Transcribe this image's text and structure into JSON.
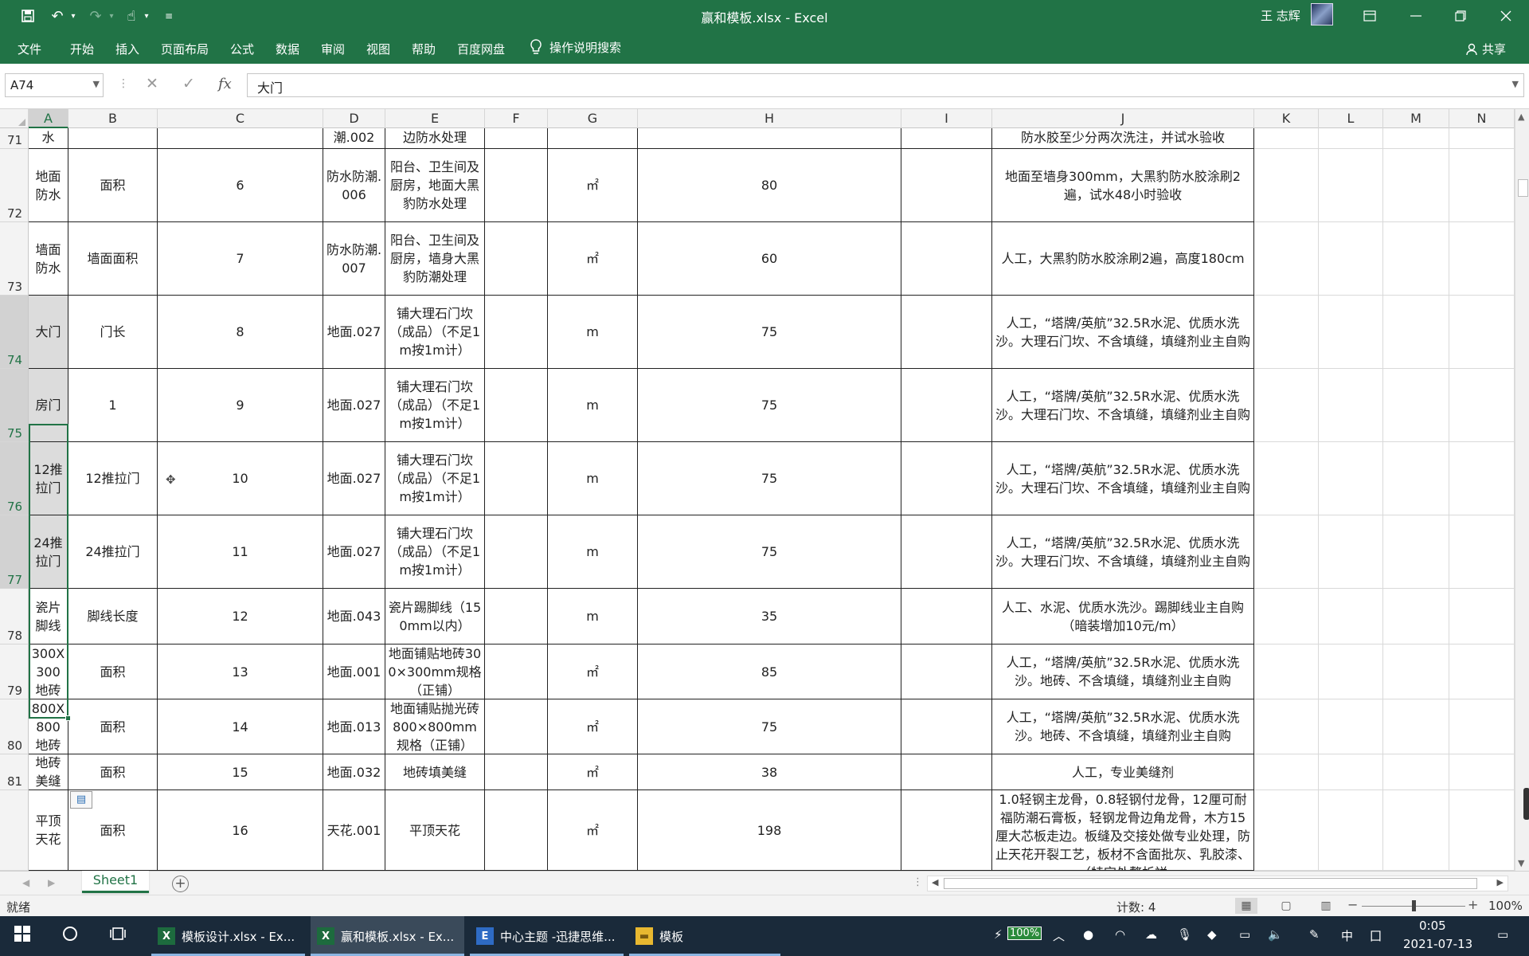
{
  "window": {
    "title": "赢和模板.xlsx  -  Excel",
    "user": "王 志辉"
  },
  "quick_access": {
    "save_icon": "save-icon",
    "undo_icon": "undo-icon",
    "redo_icon": "redo-icon",
    "touch_icon": "touch-mode-icon"
  },
  "ribbon": {
    "tabs": [
      "文件",
      "开始",
      "插入",
      "页面布局",
      "公式",
      "数据",
      "审阅",
      "视图",
      "帮助",
      "百度网盘"
    ],
    "tell_me": "操作说明搜索",
    "share": "共享"
  },
  "formula_bar": {
    "name_box": "A74",
    "fx": "fx",
    "content": "大门"
  },
  "columns": [
    "A",
    "B",
    "C",
    "D",
    "E",
    "F",
    "G",
    "H",
    "I",
    "J",
    "K",
    "L",
    "M",
    "N"
  ],
  "selected_column": "A",
  "rows": [
    {
      "num": "71",
      "A": "水",
      "B": "",
      "C": "",
      "D": "潮.002",
      "E": "边防水处理",
      "F": "",
      "G": "",
      "H": "",
      "I": "",
      "J": "防水胶至少分两次洗注，并试水验收"
    },
    {
      "num": "72",
      "A": "地面防水",
      "B": "面积",
      "C": "6",
      "D": "防水防潮.006",
      "E": "阳台、卫生间及厨房，地面大黑豹防水处理",
      "F": "",
      "G": "㎡",
      "H": "80",
      "I": "",
      "J": "地面至墙身300mm，大黑豹防水胶涂刷2遍，试水48小时验收"
    },
    {
      "num": "73",
      "A": "墙面防水",
      "B": "墙面面积",
      "C": "7",
      "D": "防水防潮.007",
      "E": "阳台、卫生间及厨房，墙身大黑豹防潮处理",
      "F": "",
      "G": "㎡",
      "H": "60",
      "I": "",
      "J": "人工，大黑豹防水胶涂刷2遍，高度180cm"
    },
    {
      "num": "74",
      "A": "大门",
      "B": "门长",
      "C": "8",
      "D": "地面.027",
      "E": "铺大理石门坎（成品）（不足1m按1m计）",
      "F": "",
      "G": "m",
      "H": "75",
      "I": "",
      "J": "人工，“塔牌/英航”32.5R水泥、优质水洗沙。大理石门坎、不含填缝，填缝剂业主自购"
    },
    {
      "num": "75",
      "A": "房门",
      "B": "1",
      "C": "9",
      "D": "地面.027",
      "E": "铺大理石门坎（成品）（不足1m按1m计）",
      "F": "",
      "G": "m",
      "H": "75",
      "I": "",
      "J": "人工，“塔牌/英航”32.5R水泥、优质水洗沙。大理石门坎、不含填缝，填缝剂业主自购"
    },
    {
      "num": "76",
      "A": "12推拉门",
      "B": "12推拉门",
      "C": "10",
      "D": "地面.027",
      "E": "铺大理石门坎（成品）（不足1m按1m计）",
      "F": "",
      "G": "m",
      "H": "75",
      "I": "",
      "J": "人工，“塔牌/英航”32.5R水泥、优质水洗沙。大理石门坎、不含填缝，填缝剂业主自购"
    },
    {
      "num": "77",
      "A": "24推拉门",
      "B": "24推拉门",
      "C": "11",
      "D": "地面.027",
      "E": "铺大理石门坎（成品）（不足1m按1m计）",
      "F": "",
      "G": "m",
      "H": "75",
      "I": "",
      "J": "人工，“塔牌/英航”32.5R水泥、优质水洗沙。大理石门坎、不含填缝，填缝剂业主自购"
    },
    {
      "num": "78",
      "A": "瓷片脚线",
      "B": "脚线长度",
      "C": "12",
      "D": "地面.043",
      "E": "瓷片踢脚线（150mm以内）",
      "F": "",
      "G": "m",
      "H": "35",
      "I": "",
      "J": "人工、水泥、优质水洗沙。踢脚线业主自购（暗装增加10元/m）"
    },
    {
      "num": "79",
      "A": "300X300地砖",
      "B": "面积",
      "C": "13",
      "D": "地面.001",
      "E": "地面铺贴地砖300×300mm规格（正铺）",
      "F": "",
      "G": "㎡",
      "H": "85",
      "I": "",
      "J": "人工，“塔牌/英航”32.5R水泥、优质水洗沙。地砖、不含填缝，填缝剂业主自购"
    },
    {
      "num": "80",
      "A": "800X800地砖",
      "B": "面积",
      "C": "14",
      "D": "地面.013",
      "E": "地面铺贴抛光砖800×800mm规格（正铺）",
      "F": "",
      "G": "㎡",
      "H": "75",
      "I": "",
      "J": "人工，“塔牌/英航”32.5R水泥、优质水洗沙。地砖、不含填缝，填缝剂业主自购"
    },
    {
      "num": "81",
      "A": "地砖美缝",
      "B": "面积",
      "C": "15",
      "D": "地面.032",
      "E": "地砖填美缝",
      "F": "",
      "G": "㎡",
      "H": "38",
      "I": "",
      "J": "人工，专业美缝剂"
    },
    {
      "num": "",
      "A": "平顶天花",
      "B": "面积",
      "C": "16",
      "D": "天花.001",
      "E": "平顶天花",
      "F": "",
      "G": "㎡",
      "H": "198",
      "I": "",
      "J": "1.0轻钢主龙骨，0.8轻钢付龙骨，12厘可耐福防潮石膏板，轻钢龙骨边角龙骨，木方15厘大芯板走边。板缝及交接处做专业处理，防止天花开裂工艺，板材不含面批灰、乳胶漆、（特定处赘析祥"
    }
  ],
  "sheet": {
    "tab": "Sheet1"
  },
  "status": {
    "ready": "就绪",
    "count": "计数: 4",
    "zoom": "100%"
  },
  "taskbar": {
    "apps": [
      {
        "label": "模板设计.xlsx - Ex...",
        "icon": "excel-icon"
      },
      {
        "label": "赢和模板.xlsx - Ex...",
        "icon": "excel-icon"
      },
      {
        "label": "中心主题 -迅捷思维...",
        "icon": "mindmap-icon"
      },
      {
        "label": "模板",
        "icon": "folder-icon"
      }
    ],
    "battery": "100%",
    "ime": "中",
    "time": "0:05",
    "date": "2021-07-13"
  },
  "colors": {
    "accent": "#217346",
    "taskbar": "#1a2a3a",
    "selected_header": "#d2d2d2"
  }
}
